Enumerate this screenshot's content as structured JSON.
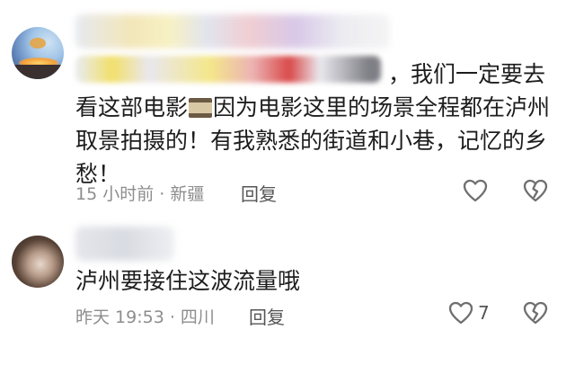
{
  "comments": [
    {
      "text_line1": "，我们一定要去",
      "text_body_before_icon": "看这部电影",
      "inline_icon": "film-strip-icon",
      "text_body_after_icon": "因为电影这里的场景全程都在泸州取景拍摄的！有我熟悉的街道和小巷，记忆的乡愁！",
      "time_location": "15 小时前 · 新疆",
      "reply_label": "回复",
      "like_count": ""
    },
    {
      "text": "泸州要接住这波流量哦",
      "time_location": "昨天 19:53 · 四川",
      "reply_label": "回复",
      "like_count": "7"
    }
  ],
  "icons": {
    "like": "heart-outline-icon",
    "dislike": "broken-heart-icon"
  },
  "colors": {
    "text": "#1d1d1d",
    "meta": "#8d8d8d",
    "icon": "#6f6f6f"
  }
}
